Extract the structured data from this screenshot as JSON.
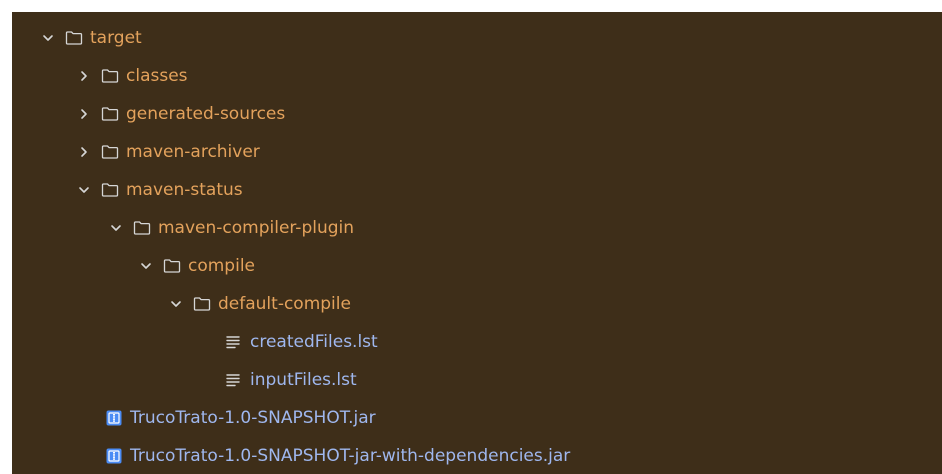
{
  "colors": {
    "background": "#3e2e19",
    "folder_text": "#e3a25c",
    "file_text": "#9fb7ee",
    "icon": "#d6d6d6",
    "jar_icon": "#4b8cf5"
  },
  "tree": {
    "items": [
      {
        "label": "target",
        "state": "expanded",
        "icon": "folder-icon"
      },
      {
        "label": "classes",
        "state": "collapsed",
        "icon": "folder-icon"
      },
      {
        "label": "generated-sources",
        "state": "collapsed",
        "icon": "folder-icon"
      },
      {
        "label": "maven-archiver",
        "state": "collapsed",
        "icon": "folder-icon"
      },
      {
        "label": "maven-status",
        "state": "expanded",
        "icon": "folder-icon"
      },
      {
        "label": "maven-compiler-plugin",
        "state": "expanded",
        "icon": "folder-icon"
      },
      {
        "label": "compile",
        "state": "expanded",
        "icon": "folder-icon"
      },
      {
        "label": "default-compile",
        "state": "expanded",
        "icon": "folder-icon"
      },
      {
        "label": "createdFiles.lst",
        "state": "leaf",
        "icon": "text-file-icon"
      },
      {
        "label": "inputFiles.lst",
        "state": "leaf",
        "icon": "text-file-icon"
      },
      {
        "label": "TrucoTrato-1.0-SNAPSHOT.jar",
        "state": "leaf",
        "icon": "jar-archive-icon"
      },
      {
        "label": "TrucoTrato-1.0-SNAPSHOT-jar-with-dependencies.jar",
        "state": "leaf",
        "icon": "jar-archive-icon"
      }
    ]
  }
}
